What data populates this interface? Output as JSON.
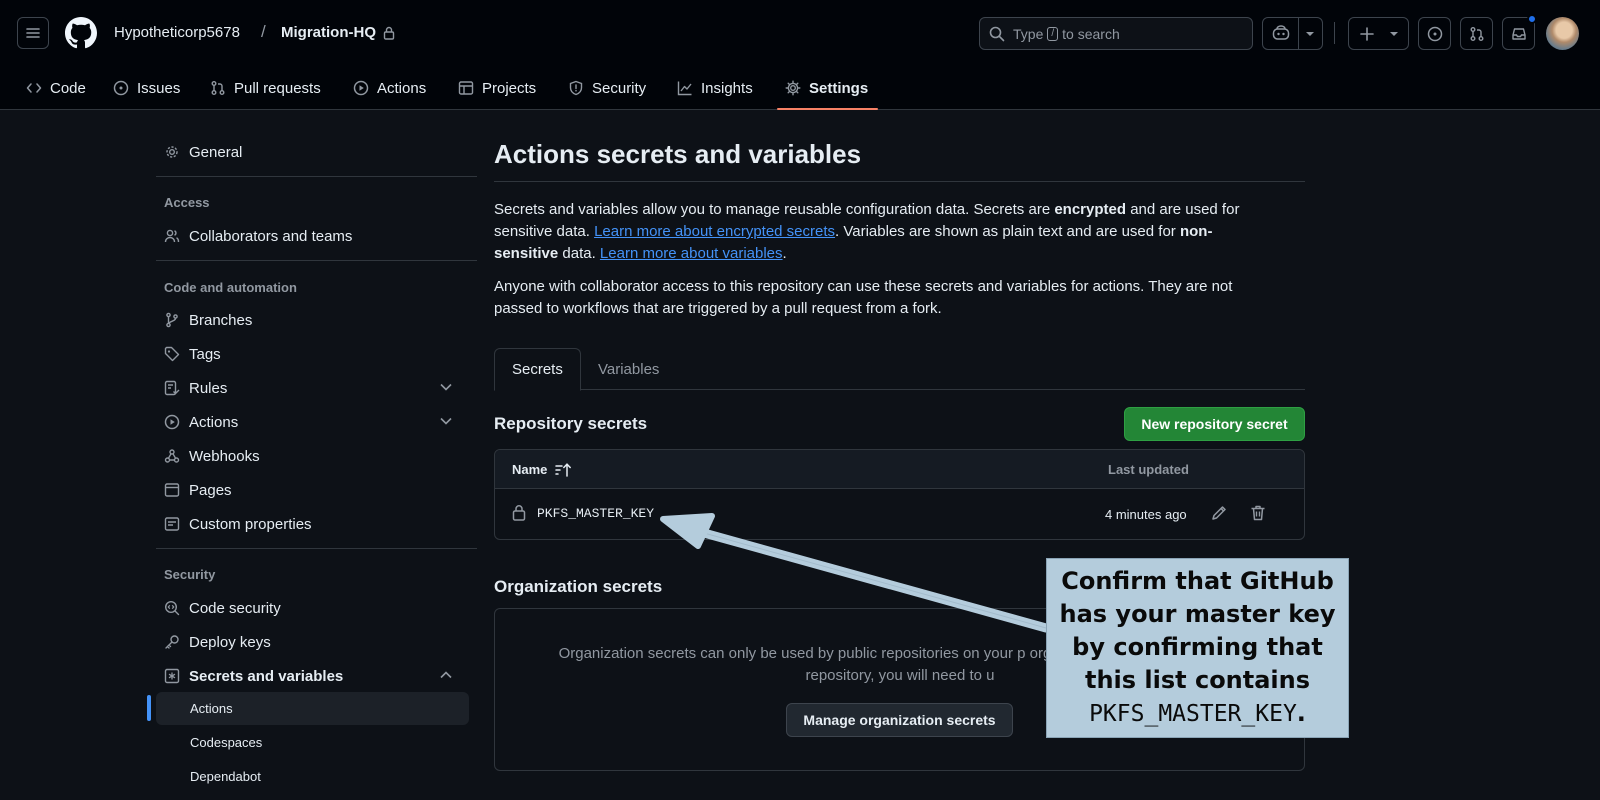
{
  "header": {
    "owner": "Hypotheticorp5678",
    "separator": "/",
    "repo": "Migration-HQ",
    "search": {
      "placeholder_pre": "Type",
      "placeholder_key": "/",
      "placeholder_post": "to search"
    }
  },
  "repo_tabs": [
    {
      "label": "Code",
      "icon": "code-icon"
    },
    {
      "label": "Issues",
      "icon": "issue-icon"
    },
    {
      "label": "Pull requests",
      "icon": "pull-request-icon"
    },
    {
      "label": "Actions",
      "icon": "play-icon"
    },
    {
      "label": "Projects",
      "icon": "table-icon"
    },
    {
      "label": "Security",
      "icon": "shield-icon"
    },
    {
      "label": "Insights",
      "icon": "graph-icon"
    },
    {
      "label": "Settings",
      "icon": "gear-icon",
      "active": true
    }
  ],
  "sidebar": {
    "general": "General",
    "access_heading": "Access",
    "collaborators": "Collaborators and teams",
    "code_heading": "Code and automation",
    "branches": "Branches",
    "tags": "Tags",
    "rules": "Rules",
    "actions": "Actions",
    "webhooks": "Webhooks",
    "pages": "Pages",
    "custom_properties": "Custom properties",
    "security_heading": "Security",
    "code_security": "Code security",
    "deploy_keys": "Deploy keys",
    "secrets_and_variables": "Secrets and variables",
    "sub": {
      "actions": "Actions",
      "codespaces": "Codespaces",
      "dependabot": "Dependabot"
    }
  },
  "main": {
    "title": "Actions secrets and variables",
    "intro": {
      "p1": "Secrets and variables allow you to manage reusable configuration data. Secrets are ",
      "encrypted": "encrypted",
      "p2": " and are used for sensitive data. ",
      "link_secrets": "Learn more about encrypted secrets",
      "p3": ". Variables are shown as plain text and are used for ",
      "non_sensitive": "non-sensitive",
      "p4": " data. ",
      "link_variables": "Learn more about variables",
      "p5": "."
    },
    "access_note": "Anyone with collaborator access to this repository can use these secrets and variables for actions. They are not passed to workflows that are triggered by a pull request from a fork.",
    "tabs": {
      "secrets": "Secrets",
      "variables": "Variables"
    },
    "repo_secrets": {
      "title": "Repository secrets",
      "new_button": "New repository secret",
      "col_name": "Name",
      "col_updated": "Last updated",
      "rows": [
        {
          "name": "PKFS_MASTER_KEY",
          "updated": "4 minutes ago"
        }
      ]
    },
    "org_secrets": {
      "title": "Organization secrets",
      "text": "Organization secrets can only be used by public repositories on your p organization secrets in a private repository, you will need to u",
      "button": "Manage organization secrets"
    }
  },
  "annotation": {
    "text": "Confirm that GitHub has your master key by confirming that this list contains",
    "code": "PKFS_MASTER_KEY",
    "period": "."
  },
  "colors": {
    "accent_link": "#4493f8",
    "primary_button": "#238636",
    "active_tab_underline": "#f78166",
    "annotation_bg": "#b4ccdc"
  }
}
